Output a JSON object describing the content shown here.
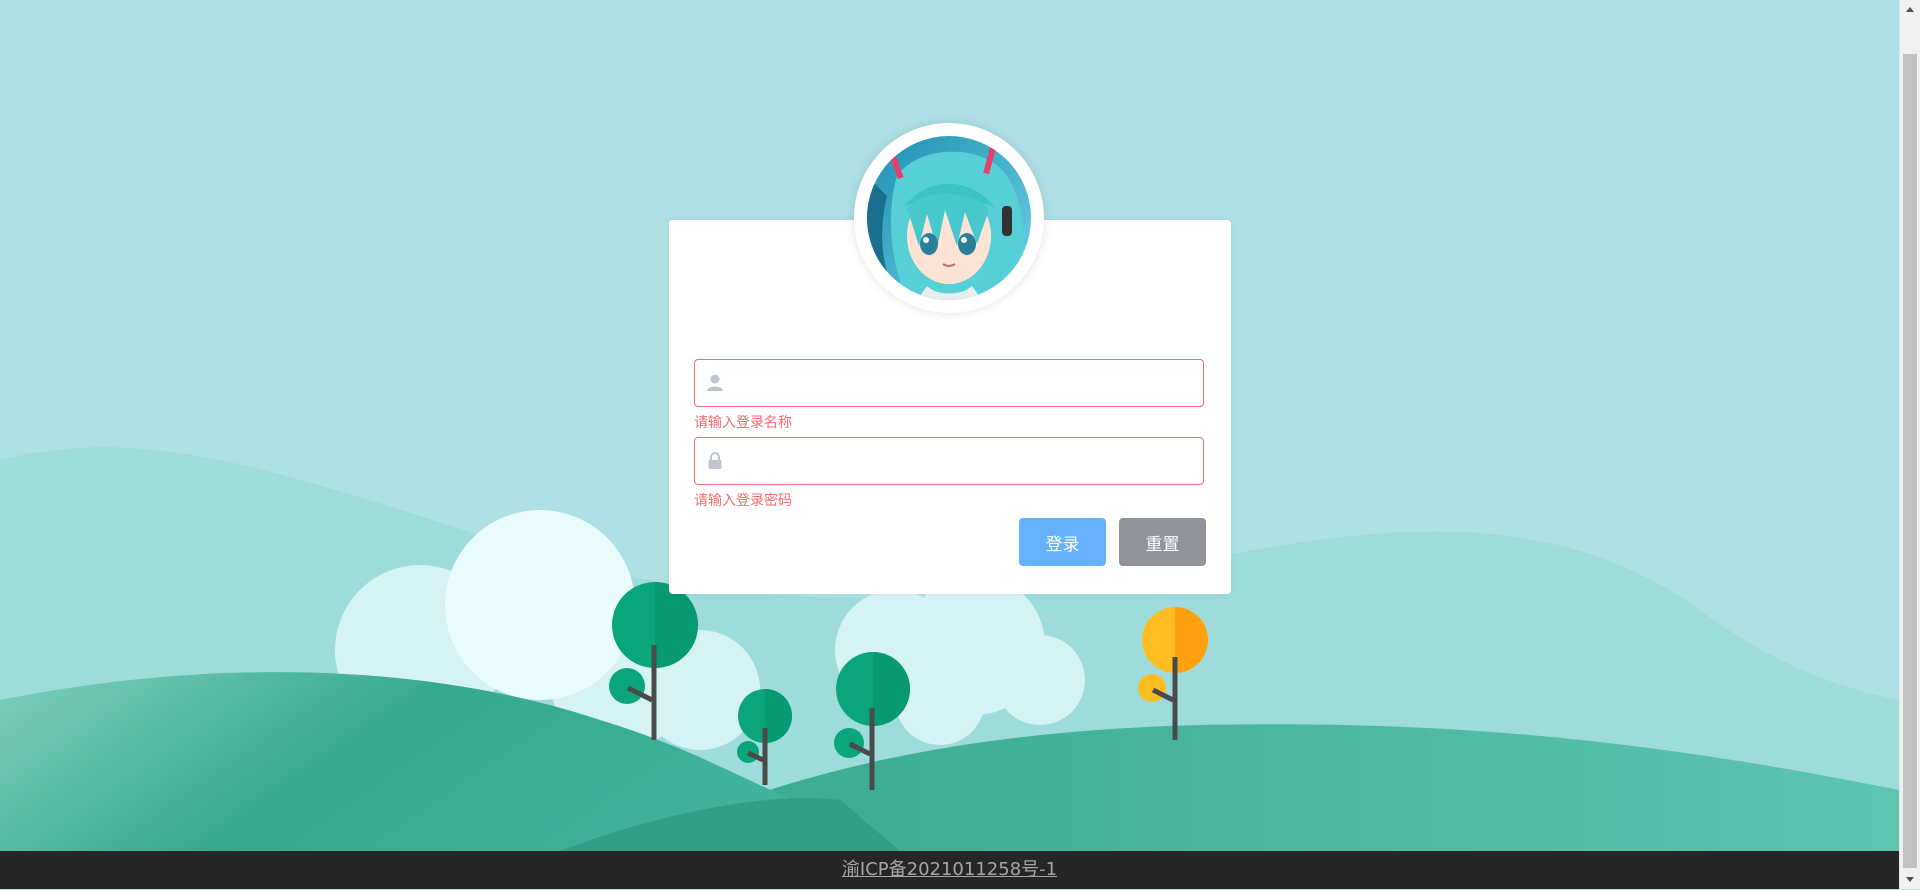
{
  "login": {
    "username": {
      "value": "",
      "placeholder": "",
      "icon": "user-icon",
      "error": "请输入登录名称"
    },
    "password": {
      "value": "",
      "placeholder": "",
      "icon": "lock-icon",
      "error": "请输入登录密码"
    },
    "login_button": "登录",
    "reset_button": "重置"
  },
  "footer": {
    "icp_text": "渝ICP备2021011258号-1"
  },
  "colors": {
    "sky": "#aee0e6",
    "error": "#f56c6c",
    "primary_button": "#66b1ff",
    "reset_button": "#909399",
    "footer": "#262626"
  }
}
